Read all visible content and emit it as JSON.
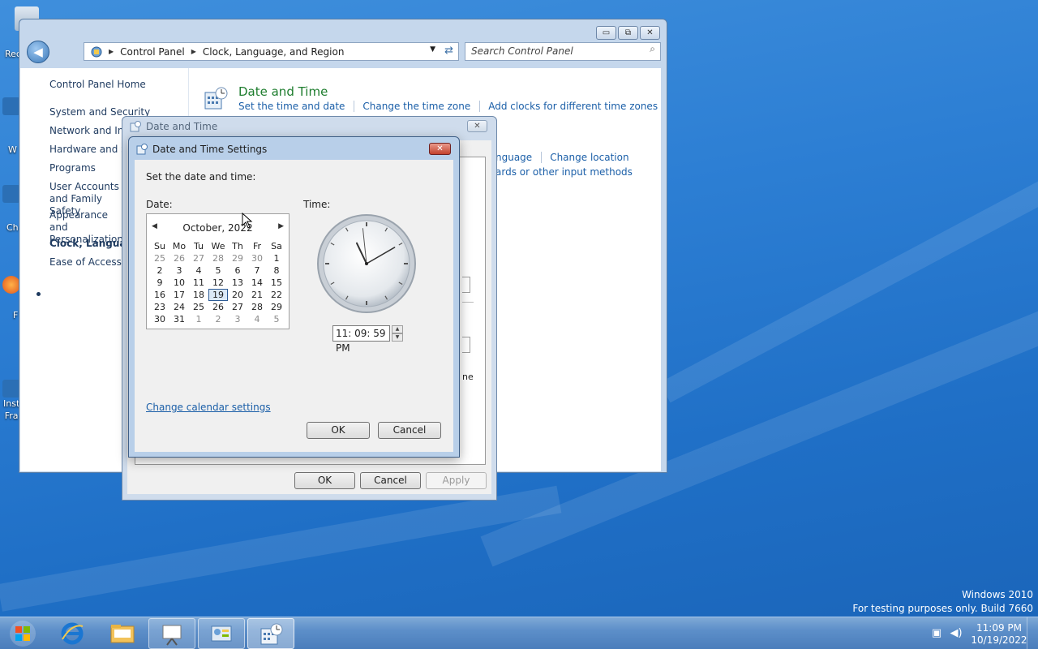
{
  "desktop": {
    "icon_labels": [
      "Rec",
      "W",
      "Ch",
      "F",
      "Inst\nFra"
    ]
  },
  "explorer": {
    "window_controls": {
      "minimize": "▭",
      "maximize": "⧉",
      "close": "✕"
    },
    "back_glyph": "◀",
    "breadcrumb": [
      "Control Panel",
      "Clock, Language, and Region"
    ],
    "search_placeholder": "Search Control Panel",
    "nav": {
      "home": "Control Panel Home",
      "items": [
        "System and Security",
        "Network and Internet",
        "Hardware and Sound",
        "Programs",
        "User Accounts and Family Safety",
        "Appearance and Personalization",
        "Clock, Language, and Region",
        "Ease of Access"
      ]
    },
    "category": {
      "title": "Date and Time",
      "links": [
        "Set the time and date",
        "Change the time zone",
        "Add clocks for different time zones"
      ]
    },
    "partial_links_row1": [
      "nguage",
      "Change location"
    ],
    "partial_links_row2": "ards or other input methods"
  },
  "dt_window": {
    "title": "Date and Time",
    "close_glyph": "✕",
    "partial_text": "ne",
    "buttons": {
      "ok": "OK",
      "cancel": "Cancel",
      "apply": "Apply"
    }
  },
  "settings": {
    "title": "Date and Time Settings",
    "close_glyph": "✕",
    "instruction": "Set the date and time:",
    "date_label": "Date:",
    "time_label": "Time:",
    "calendar": {
      "month_title": "October, 2022",
      "prev": "◀",
      "next": "▶",
      "weekdays": [
        "Su",
        "Mo",
        "Tu",
        "We",
        "Th",
        "Fr",
        "Sa"
      ],
      "weeks": [
        [
          "25",
          "26",
          "27",
          "28",
          "29",
          "30",
          "1"
        ],
        [
          "2",
          "3",
          "4",
          "5",
          "6",
          "7",
          "8"
        ],
        [
          "9",
          "10",
          "11",
          "12",
          "13",
          "14",
          "15"
        ],
        [
          "16",
          "17",
          "18",
          "19",
          "20",
          "21",
          "22"
        ],
        [
          "23",
          "24",
          "25",
          "26",
          "27",
          "28",
          "29"
        ],
        [
          "30",
          "31",
          "1",
          "2",
          "3",
          "4",
          "5"
        ]
      ],
      "selected_day": "19"
    },
    "clock": {
      "hours": 23,
      "minutes": 9,
      "seconds": 59
    },
    "time_value": "11: 09: 59 PM",
    "spin_up": "▲",
    "spin_down": "▼",
    "calendar_settings_link": "Change calendar settings",
    "buttons": {
      "ok": "OK",
      "cancel": "Cancel"
    }
  },
  "watermark": {
    "line1": "Windows 2010",
    "line2": "For testing purposes only. Build 7660"
  },
  "taskbar": {
    "apps": [
      "internet-explorer",
      "windows-explorer",
      "presentation",
      "control-panel",
      "date-and-time"
    ],
    "tray": {
      "time": "11:09 PM",
      "date": "10/19/2022"
    }
  }
}
